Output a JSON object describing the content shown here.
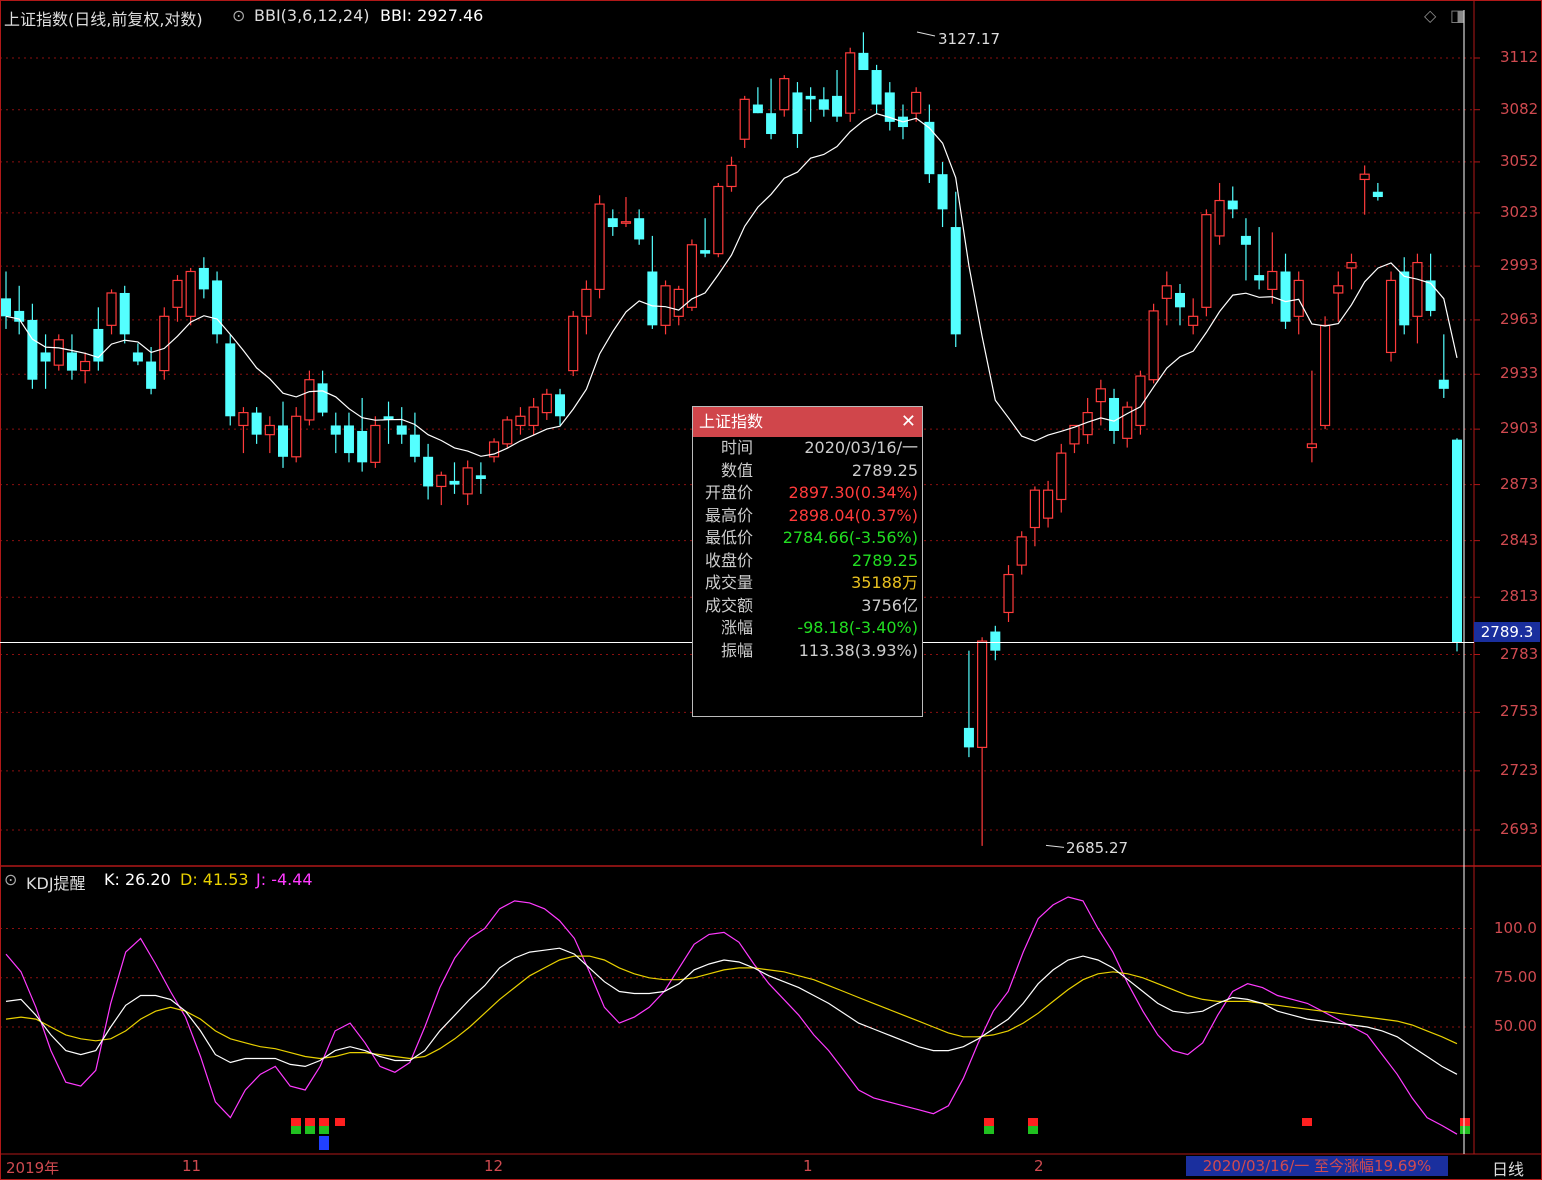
{
  "header": {
    "title": "上证指数(日线,前复权,对数)",
    "indicator_params": "BBI(3,6,12,24)",
    "indicator_value": "BBI: 2927.46"
  },
  "price_axis": [
    "3112",
    "3082",
    "3052",
    "3023",
    "2993",
    "2963",
    "2933",
    "2903",
    "2873",
    "2843",
    "2813",
    "2783",
    "2753",
    "2723",
    "2693"
  ],
  "current_price_tag": "2789.3",
  "annotations": {
    "high": "3127.17",
    "low": "2685.27"
  },
  "tooltip": {
    "title": "上证指数",
    "rows": [
      {
        "label": "时间",
        "value": "2020/03/16/一",
        "color": "#cccccc"
      },
      {
        "label": "数值",
        "value": "2789.25",
        "color": "#cccccc"
      },
      {
        "label": "开盘价",
        "value": "2897.30(0.34%)",
        "color": "#ff3b3b"
      },
      {
        "label": "最高价",
        "value": "2898.04(0.37%)",
        "color": "#ff3b3b"
      },
      {
        "label": "最低价",
        "value": "2784.66(-3.56%)",
        "color": "#22dd22"
      },
      {
        "label": "收盘价",
        "value": "2789.25",
        "color": "#22dd22"
      },
      {
        "label": "成交量",
        "value": "35188万",
        "color": "#e8c020"
      },
      {
        "label": "成交额",
        "value": "3756亿",
        "color": "#cccccc"
      },
      {
        "label": "涨幅",
        "value": "-98.18(-3.40%)",
        "color": "#22dd22"
      },
      {
        "label": "振幅",
        "value": "113.38(3.93%)",
        "color": "#cccccc"
      }
    ]
  },
  "kdj": {
    "name": "KDJ提醒",
    "k": "K: 26.20",
    "d": "D: 41.53",
    "j": "J: -4.44",
    "axis": [
      "100.0",
      "75.00",
      "50.00"
    ]
  },
  "x_axis": [
    "2019年",
    "11",
    "12",
    "1",
    "2"
  ],
  "footer": {
    "range_text": "2020/03/16/一  至今涨幅19.69%",
    "period": "日线"
  },
  "colors": {
    "up": "#ff3b3b",
    "down": "#54ffff",
    "bbi": "#ffffff",
    "k": "#ffffff",
    "d": "#e8d000",
    "j": "#ff3aff",
    "grid": "#8b1010"
  },
  "chart_data": {
    "type": "candlestick",
    "title": "上证指数(日线,前复权,对数)",
    "ylim": [
      2685.27,
      3127.17
    ],
    "candles": [
      [
        2975,
        2990,
        2958,
        2965
      ],
      [
        2968,
        2982,
        2955,
        2962
      ],
      [
        2963,
        2972,
        2925,
        2930
      ],
      [
        2945,
        2955,
        2925,
        2940
      ],
      [
        2938,
        2955,
        2935,
        2952
      ],
      [
        2945,
        2955,
        2930,
        2935
      ],
      [
        2935,
        2945,
        2928,
        2940
      ],
      [
        2958,
        2970,
        2935,
        2940
      ],
      [
        2960,
        2980,
        2955,
        2978
      ],
      [
        2978,
        2982,
        2950,
        2955
      ],
      [
        2945,
        2950,
        2938,
        2940
      ],
      [
        2940,
        2948,
        2922,
        2925
      ],
      [
        2935,
        2970,
        2930,
        2965
      ],
      [
        2970,
        2988,
        2962,
        2985
      ],
      [
        2965,
        2992,
        2960,
        2990
      ],
      [
        2992,
        2998,
        2975,
        2980
      ],
      [
        2985,
        2990,
        2950,
        2955
      ],
      [
        2950,
        2955,
        2905,
        2910
      ],
      [
        2905,
        2915,
        2890,
        2912
      ],
      [
        2912,
        2915,
        2895,
        2900
      ],
      [
        2900,
        2910,
        2890,
        2905
      ],
      [
        2905,
        2918,
        2882,
        2888
      ],
      [
        2888,
        2915,
        2885,
        2910
      ],
      [
        2908,
        2935,
        2905,
        2930
      ],
      [
        2928,
        2935,
        2910,
        2912
      ],
      [
        2905,
        2912,
        2890,
        2900
      ],
      [
        2905,
        2912,
        2885,
        2890
      ],
      [
        2902,
        2920,
        2880,
        2885
      ],
      [
        2885,
        2910,
        2882,
        2905
      ],
      [
        2910,
        2918,
        2895,
        2908
      ],
      [
        2905,
        2915,
        2895,
        2900
      ],
      [
        2900,
        2912,
        2885,
        2888
      ],
      [
        2888,
        2895,
        2865,
        2872
      ],
      [
        2872,
        2880,
        2862,
        2878
      ],
      [
        2875,
        2885,
        2868,
        2873
      ],
      [
        2868,
        2886,
        2862,
        2882
      ],
      [
        2878,
        2885,
        2868,
        2876
      ],
      [
        2888,
        2898,
        2885,
        2896
      ],
      [
        2895,
        2910,
        2893,
        2908
      ],
      [
        2905,
        2915,
        2900,
        2910
      ],
      [
        2905,
        2920,
        2900,
        2915
      ],
      [
        2912,
        2925,
        2908,
        2922
      ],
      [
        2922,
        2925,
        2905,
        2910
      ],
      [
        2935,
        2968,
        2932,
        2965
      ],
      [
        2965,
        2985,
        2955,
        2980
      ],
      [
        2980,
        3033,
        2975,
        3028
      ],
      [
        3020,
        3025,
        3010,
        3015
      ],
      [
        3018,
        3032,
        3015,
        3018
      ],
      [
        3020,
        3025,
        3005,
        3008
      ],
      [
        2990,
        3010,
        2958,
        2960
      ],
      [
        2960,
        2985,
        2955,
        2982
      ],
      [
        2965,
        2982,
        2960,
        2980
      ],
      [
        2970,
        3008,
        2968,
        3005
      ],
      [
        3002,
        3020,
        2998,
        3000
      ],
      [
        3000,
        3040,
        2998,
        3038
      ],
      [
        3038,
        3055,
        3035,
        3050
      ],
      [
        3065,
        3090,
        3060,
        3088
      ],
      [
        3085,
        3095,
        3080,
        3080
      ],
      [
        3080,
        3100,
        3065,
        3068
      ],
      [
        3082,
        3102,
        3078,
        3100
      ],
      [
        3092,
        3098,
        3060,
        3068
      ],
      [
        3090,
        3095,
        3075,
        3088
      ],
      [
        3088,
        3095,
        3078,
        3082
      ],
      [
        3090,
        3105,
        3075,
        3078
      ],
      [
        3080,
        3118,
        3075,
        3115
      ],
      [
        3115,
        3127,
        3110,
        3105
      ],
      [
        3105,
        3108,
        3080,
        3085
      ],
      [
        3092,
        3098,
        3070,
        3075
      ],
      [
        3078,
        3085,
        3065,
        3072
      ],
      [
        3080,
        3095,
        3075,
        3092
      ],
      [
        3075,
        3085,
        3040,
        3045
      ],
      [
        3045,
        3052,
        3015,
        3025
      ],
      [
        3015,
        3035,
        2948,
        2955
      ],
      [
        2745,
        2785,
        2730,
        2735
      ],
      [
        2735,
        2792,
        2685,
        2790
      ],
      [
        2795,
        2798,
        2780,
        2785
      ],
      [
        2805,
        2830,
        2800,
        2825
      ],
      [
        2830,
        2848,
        2825,
        2845
      ],
      [
        2850,
        2872,
        2840,
        2870
      ],
      [
        2855,
        2875,
        2850,
        2870
      ],
      [
        2865,
        2895,
        2858,
        2890
      ],
      [
        2895,
        2905,
        2890,
        2905
      ],
      [
        2900,
        2920,
        2895,
        2912
      ],
      [
        2918,
        2930,
        2905,
        2925
      ],
      [
        2920,
        2925,
        2895,
        2902
      ],
      [
        2898,
        2918,
        2893,
        2915
      ],
      [
        2905,
        2935,
        2900,
        2932
      ],
      [
        2930,
        2972,
        2928,
        2968
      ],
      [
        2975,
        2990,
        2960,
        2982
      ],
      [
        2978,
        2983,
        2960,
        2970
      ],
      [
        2960,
        2975,
        2955,
        2965
      ],
      [
        2970,
        3025,
        2965,
        3022
      ],
      [
        3010,
        3040,
        3005,
        3030
      ],
      [
        3030,
        3038,
        3020,
        3025
      ],
      [
        3010,
        3020,
        2985,
        3005
      ],
      [
        2988,
        3015,
        2980,
        2985
      ],
      [
        2980,
        3012,
        2972,
        2990
      ],
      [
        2990,
        3000,
        2958,
        2962
      ],
      [
        2965,
        2990,
        2955,
        2985
      ],
      [
        2893,
        2935,
        2885,
        2895
      ],
      [
        2905,
        2965,
        2903,
        2960
      ],
      [
        2978,
        2990,
        2962,
        2982
      ],
      [
        2992,
        3000,
        2980,
        2995
      ],
      [
        3042,
        3050,
        3022,
        3045
      ],
      [
        3035,
        3040,
        3030,
        3032
      ],
      [
        2945,
        2990,
        2940,
        2985
      ],
      [
        2990,
        2998,
        2955,
        2960
      ],
      [
        2965,
        3000,
        2950,
        2995
      ],
      [
        2985,
        3000,
        2965,
        2968
      ],
      [
        2930,
        2955,
        2920,
        2925
      ],
      [
        2897.3,
        2898.04,
        2784.66,
        2789.25
      ]
    ],
    "kdj_series": {
      "K": [
        63,
        64,
        56,
        46,
        38,
        36,
        38,
        50,
        61,
        66,
        66,
        64,
        58,
        48,
        36,
        32,
        34,
        34,
        34,
        31,
        30,
        33,
        38,
        40,
        38,
        35,
        33,
        33,
        38,
        48,
        56,
        64,
        71,
        80,
        85,
        88,
        89,
        90,
        87,
        80,
        73,
        68,
        67,
        67,
        68,
        72,
        79,
        82,
        84,
        83,
        80,
        76,
        73,
        70,
        66,
        62,
        57,
        52,
        49,
        46,
        43,
        40,
        38,
        38,
        40,
        44,
        49,
        54,
        62,
        72,
        79,
        84,
        86,
        84,
        80,
        74,
        68,
        62,
        58,
        57,
        58,
        62,
        65,
        64,
        62,
        58,
        56,
        54,
        53,
        52,
        51,
        50,
        48,
        45,
        40,
        35,
        30,
        26
      ],
      "D": [
        54,
        55,
        54,
        50,
        46,
        44,
        43,
        44,
        48,
        54,
        58,
        60,
        58,
        54,
        48,
        44,
        42,
        40,
        39,
        37,
        35,
        34,
        35,
        37,
        37,
        36,
        35,
        34,
        35,
        39,
        44,
        50,
        57,
        64,
        70,
        76,
        80,
        84,
        86,
        86,
        84,
        80,
        77,
        75,
        74,
        74,
        75,
        77,
        79,
        80,
        80,
        79,
        78,
        76,
        74,
        71,
        68,
        65,
        62,
        59,
        56,
        53,
        50,
        47,
        45,
        45,
        46,
        48,
        52,
        57,
        63,
        69,
        74,
        77,
        78,
        77,
        75,
        72,
        69,
        66,
        64,
        63,
        63,
        63,
        62,
        61,
        60,
        59,
        58,
        57,
        56,
        55,
        54,
        53,
        51,
        48,
        45,
        41.53
      ],
      "J": [
        87,
        78,
        60,
        38,
        22,
        20,
        28,
        62,
        88,
        95,
        82,
        68,
        55,
        35,
        12,
        4,
        18,
        26,
        30,
        20,
        18,
        30,
        48,
        52,
        42,
        30,
        27,
        32,
        50,
        70,
        85,
        95,
        100,
        110,
        114,
        113,
        110,
        104,
        95,
        78,
        60,
        52,
        55,
        60,
        68,
        80,
        92,
        97,
        98,
        93,
        82,
        72,
        64,
        56,
        46,
        38,
        28,
        18,
        14,
        12,
        10,
        8,
        6,
        10,
        24,
        42,
        58,
        68,
        88,
        105,
        112,
        116,
        114,
        100,
        88,
        72,
        58,
        46,
        38,
        36,
        42,
        56,
        68,
        72,
        70,
        66,
        64,
        62,
        58,
        54,
        50,
        46,
        36,
        26,
        14,
        4,
        0,
        -4.44
      ]
    }
  }
}
